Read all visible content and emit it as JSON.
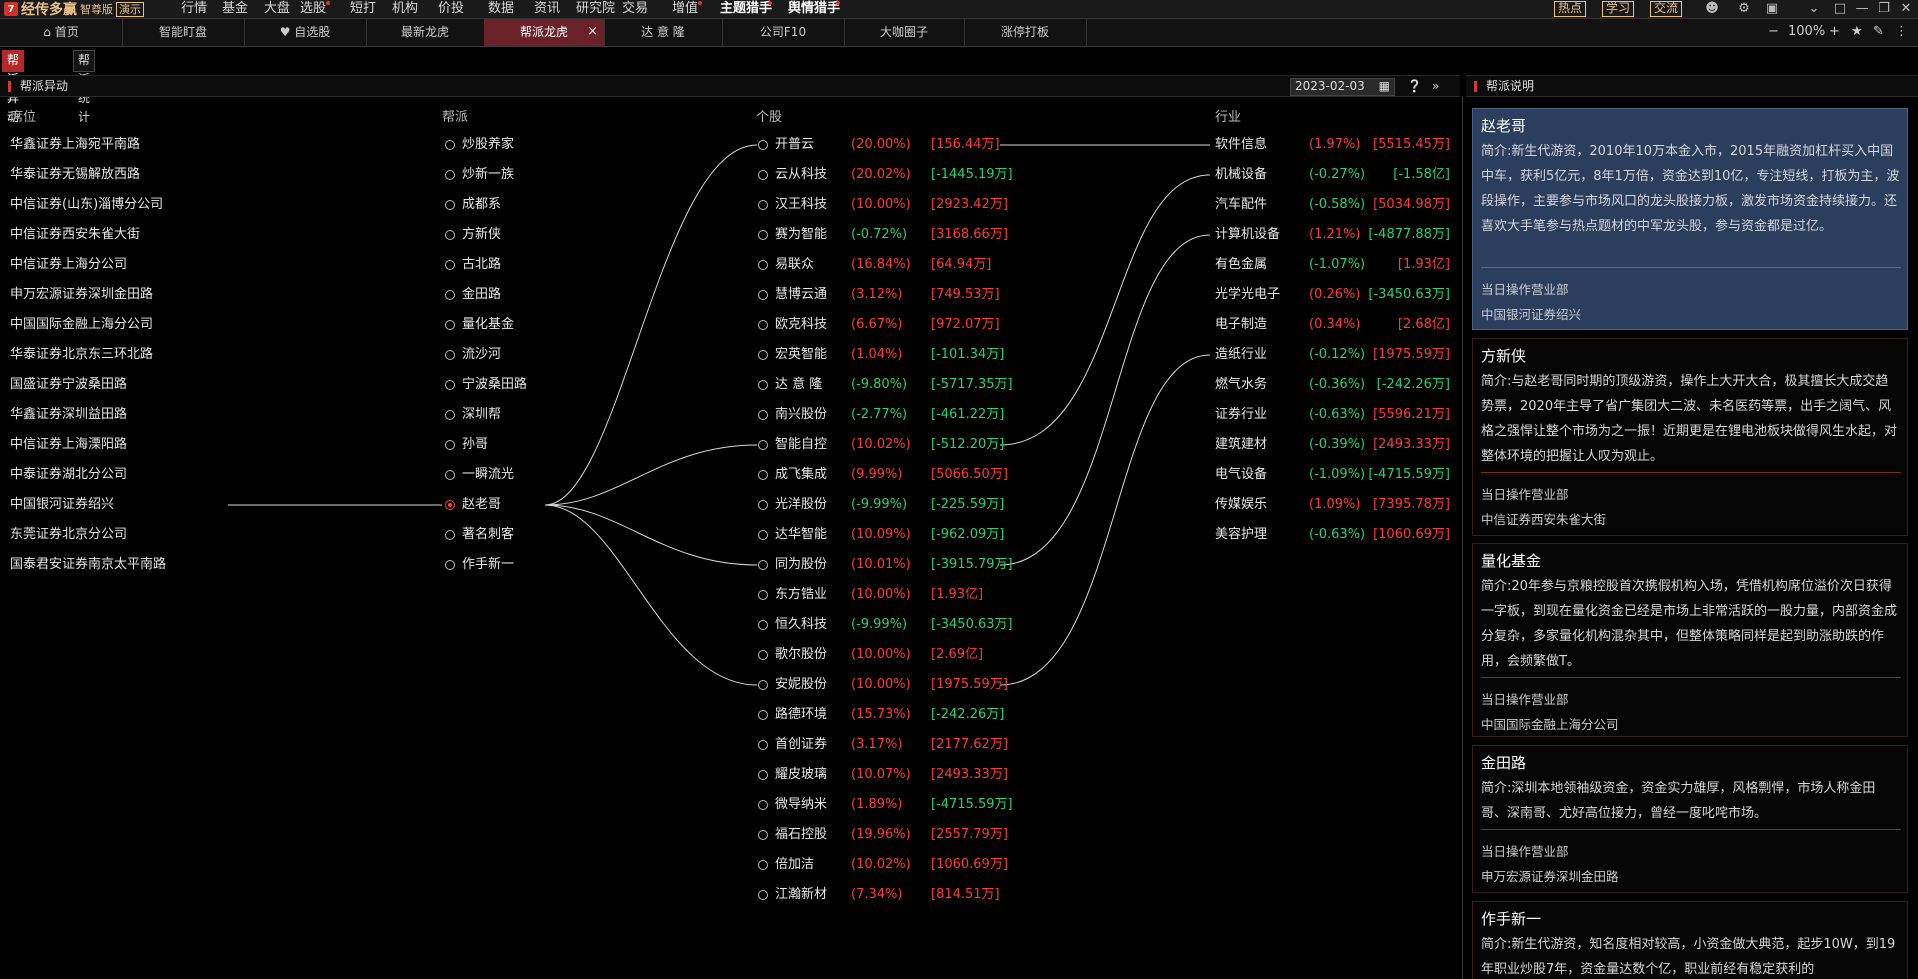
{
  "app": {
    "logo_mark": "7",
    "name": "经传多赢",
    "edition": "智尊版",
    "demo": "演示"
  },
  "menu": [
    {
      "label": "行情",
      "dot": false
    },
    {
      "label": "基金",
      "dot": false
    },
    {
      "label": "大盘",
      "dot": false
    },
    {
      "label": "选股",
      "dot": true
    },
    {
      "label": "短打",
      "dot": false
    },
    {
      "label": "机构",
      "dot": false
    },
    {
      "label": "价投",
      "dot": false
    },
    {
      "label": "数据",
      "dot": false
    },
    {
      "label": "资讯",
      "dot": false
    },
    {
      "label": "研究院",
      "dot": false
    },
    {
      "label": "交易",
      "dot": false
    },
    {
      "label": "增值",
      "dot": true
    },
    {
      "label": "主题猎手",
      "dot": true
    },
    {
      "label": "舆情猎手",
      "dot": true
    }
  ],
  "right_tags": [
    "热点",
    "学习",
    "交流"
  ],
  "window_icons": [
    "user-icon",
    "settings-icon",
    "skin-icon",
    "collapse-icon",
    "restore-icon",
    "minimize-icon",
    "maximize-icon",
    "close-icon"
  ],
  "tabs": [
    {
      "label": "首页",
      "icon": "home-icon"
    },
    {
      "label": "智能盯盘"
    },
    {
      "label": "自选股",
      "icon": "heart-icon"
    },
    {
      "label": "最新龙虎"
    },
    {
      "label": "帮派龙虎",
      "active": true,
      "close": "×"
    },
    {
      "label": "达 意 隆"
    },
    {
      "label": "公司F10"
    },
    {
      "label": "大咖圈子"
    },
    {
      "label": "涨停打板"
    }
  ],
  "zoom": {
    "minus": "−",
    "value": "100%",
    "plus": "+"
  },
  "subtabs": [
    {
      "label": "帮派异动",
      "active": true
    },
    {
      "label": "帮派统计"
    }
  ],
  "left_panel": {
    "title": "帮派异动",
    "date": "2023-02-03"
  },
  "right_panel": {
    "title": "帮派说明"
  },
  "columns": {
    "seat": "席位",
    "gang": "帮派",
    "stock": "个股",
    "industry": "行业"
  },
  "seats": [
    "华鑫证券上海宛平南路",
    "华泰证券无锡解放西路",
    "中信证券(山东)淄博分公司",
    "中信证券西安朱雀大街",
    "中信证券上海分公司",
    "申万宏源证券深圳金田路",
    "中国国际金融上海分公司",
    "华泰证券北京东三环北路",
    "国盛证券宁波桑田路",
    "华鑫证券深圳益田路",
    "中信证券上海溧阳路",
    "中泰证券湖北分公司",
    "中国银河证券绍兴",
    "东莞证券北京分公司",
    "国泰君安证券南京太平南路"
  ],
  "gangs": [
    {
      "name": "炒股养家"
    },
    {
      "name": "炒新一族"
    },
    {
      "name": "成都系"
    },
    {
      "name": "方新侠"
    },
    {
      "name": "古北路"
    },
    {
      "name": "金田路"
    },
    {
      "name": "量化基金"
    },
    {
      "name": "流沙河"
    },
    {
      "name": "宁波桑田路"
    },
    {
      "name": "深圳帮"
    },
    {
      "name": "孙哥"
    },
    {
      "name": "一瞬流光"
    },
    {
      "name": "赵老哥",
      "selected": true
    },
    {
      "name": "著名刺客"
    },
    {
      "name": "作手新一"
    }
  ],
  "stocks": [
    {
      "name": "开普云",
      "pct": "(20.00%)",
      "amt": "[156.44万]",
      "pct_dir": "up",
      "amt_dir": "up"
    },
    {
      "name": "云从科技",
      "pct": "(20.02%)",
      "amt": "[-1445.19万]",
      "pct_dir": "up",
      "amt_dir": "down"
    },
    {
      "name": "汉王科技",
      "pct": "(10.00%)",
      "amt": "[2923.42万]",
      "pct_dir": "up",
      "amt_dir": "up"
    },
    {
      "name": "赛为智能",
      "pct": "(-0.72%)",
      "amt": "[3168.66万]",
      "pct_dir": "down",
      "amt_dir": "up"
    },
    {
      "name": "易联众",
      "pct": "(16.84%)",
      "amt": "[64.94万]",
      "pct_dir": "up",
      "amt_dir": "up"
    },
    {
      "name": "慧博云通",
      "pct": "(3.12%)",
      "amt": "[749.53万]",
      "pct_dir": "up",
      "amt_dir": "up"
    },
    {
      "name": "欧克科技",
      "pct": "(6.67%)",
      "amt": "[972.07万]",
      "pct_dir": "up",
      "amt_dir": "up"
    },
    {
      "name": "宏英智能",
      "pct": "(1.04%)",
      "amt": "[-101.34万]",
      "pct_dir": "up",
      "amt_dir": "down"
    },
    {
      "name": "达 意 隆",
      "pct": "(-9.80%)",
      "amt": "[-5717.35万]",
      "pct_dir": "down",
      "amt_dir": "down"
    },
    {
      "name": "南兴股份",
      "pct": "(-2.77%)",
      "amt": "[-461.22万]",
      "pct_dir": "down",
      "amt_dir": "down"
    },
    {
      "name": "智能自控",
      "pct": "(10.02%)",
      "amt": "[-512.20万]",
      "pct_dir": "up",
      "amt_dir": "down"
    },
    {
      "name": "成飞集成",
      "pct": "(9.99%)",
      "amt": "[5066.50万]",
      "pct_dir": "up",
      "amt_dir": "up"
    },
    {
      "name": "光洋股份",
      "pct": "(-9.99%)",
      "amt": "[-225.59万]",
      "pct_dir": "down",
      "amt_dir": "down"
    },
    {
      "name": "达华智能",
      "pct": "(10.09%)",
      "amt": "[-962.09万]",
      "pct_dir": "up",
      "amt_dir": "down"
    },
    {
      "name": "同为股份",
      "pct": "(10.01%)",
      "amt": "[-3915.79万]",
      "pct_dir": "up",
      "amt_dir": "down"
    },
    {
      "name": "东方锆业",
      "pct": "(10.00%)",
      "amt": "[1.93亿]",
      "pct_dir": "up",
      "amt_dir": "up"
    },
    {
      "name": "恒久科技",
      "pct": "(-9.99%)",
      "amt": "[-3450.63万]",
      "pct_dir": "down",
      "amt_dir": "down"
    },
    {
      "name": "歌尔股份",
      "pct": "(10.00%)",
      "amt": "[2.69亿]",
      "pct_dir": "up",
      "amt_dir": "up"
    },
    {
      "name": "安妮股份",
      "pct": "(10.00%)",
      "amt": "[1975.59万]",
      "pct_dir": "up",
      "amt_dir": "up"
    },
    {
      "name": "路德环境",
      "pct": "(15.73%)",
      "amt": "[-242.26万]",
      "pct_dir": "up",
      "amt_dir": "down"
    },
    {
      "name": "首创证券",
      "pct": "(3.17%)",
      "amt": "[2177.62万]",
      "pct_dir": "up",
      "amt_dir": "up"
    },
    {
      "name": "耀皮玻璃",
      "pct": "(10.07%)",
      "amt": "[2493.33万]",
      "pct_dir": "up",
      "amt_dir": "up"
    },
    {
      "name": "微导纳米",
      "pct": "(1.89%)",
      "amt": "[-4715.59万]",
      "pct_dir": "up",
      "amt_dir": "down"
    },
    {
      "name": "福石控股",
      "pct": "(19.96%)",
      "amt": "[2557.79万]",
      "pct_dir": "up",
      "amt_dir": "up"
    },
    {
      "name": "倍加洁",
      "pct": "(10.02%)",
      "amt": "[1060.69万]",
      "pct_dir": "up",
      "amt_dir": "up"
    },
    {
      "name": "江瀚新材",
      "pct": "(7.34%)",
      "amt": "[814.51万]",
      "pct_dir": "up",
      "amt_dir": "up"
    }
  ],
  "industries": [
    {
      "name": "软件信息",
      "pct": "(1.97%)",
      "amt": "[5515.45万]",
      "pct_dir": "up",
      "amt_dir": "up"
    },
    {
      "name": "机械设备",
      "pct": "(-0.27%)",
      "amt": "[-1.58亿]",
      "pct_dir": "down",
      "amt_dir": "down"
    },
    {
      "name": "汽车配件",
      "pct": "(-0.58%)",
      "amt": "[5034.98万]",
      "pct_dir": "down",
      "amt_dir": "up"
    },
    {
      "name": "计算机设备",
      "pct": "(1.21%)",
      "amt": "[-4877.88万]",
      "pct_dir": "up",
      "amt_dir": "down"
    },
    {
      "name": "有色金属",
      "pct": "(-1.07%)",
      "amt": "[1.93亿]",
      "pct_dir": "down",
      "amt_dir": "up"
    },
    {
      "name": "光学光电子",
      "pct": "(0.26%)",
      "amt": "[-3450.63万]",
      "pct_dir": "up",
      "amt_dir": "down"
    },
    {
      "name": "电子制造",
      "pct": "(0.34%)",
      "amt": "[2.68亿]",
      "pct_dir": "up",
      "amt_dir": "up"
    },
    {
      "name": "造纸行业",
      "pct": "(-0.12%)",
      "amt": "[1975.59万]",
      "pct_dir": "down",
      "amt_dir": "up"
    },
    {
      "name": "燃气水务",
      "pct": "(-0.36%)",
      "amt": "[-242.26万]",
      "pct_dir": "down",
      "amt_dir": "down"
    },
    {
      "name": "证券行业",
      "pct": "(-0.63%)",
      "amt": "[5596.21万]",
      "pct_dir": "down",
      "amt_dir": "up"
    },
    {
      "name": "建筑建材",
      "pct": "(-0.39%)",
      "amt": "[2493.33万]",
      "pct_dir": "down",
      "amt_dir": "up"
    },
    {
      "name": "电气设备",
      "pct": "(-1.09%)",
      "amt": "[-4715.59万]",
      "pct_dir": "down",
      "amt_dir": "down"
    },
    {
      "name": "传媒娱乐",
      "pct": "(1.09%)",
      "amt": "[7395.78万]",
      "pct_dir": "up",
      "amt_dir": "up"
    },
    {
      "name": "美容护理",
      "pct": "(-0.63%)",
      "amt": "[1060.69万]",
      "pct_dir": "down",
      "amt_dir": "up"
    }
  ],
  "links": {
    "selected_seat_index": 12,
    "selected_gang_index": 12,
    "gang_to_stocks": [
      0,
      10,
      14,
      18
    ],
    "stock_to_industry": [
      [
        0,
        0
      ],
      [
        10,
        1
      ],
      [
        14,
        3
      ],
      [
        18,
        7
      ]
    ]
  },
  "cards": [
    {
      "title": "赵老哥",
      "active": true,
      "desc": "简介:新生代游资，2010年10万本金入市，2015年融资加杠杆买入中国中车，获利5亿元，8年1万倍，资金达到10亿，专注短线，打板为主，波段操作，主要参与市场风口的龙头股接力板，激发市场资金持续接力。还喜欢大手笔参与热点题材的中军龙头股，参与资金都是过亿。",
      "label": "当日操作营业部",
      "branch": "中国银河证券绍兴"
    },
    {
      "title": "方新侠",
      "active": false,
      "desc": "简介:与赵老哥同时期的顶级游资，操作上大开大合，极其擅长大成交趋势票，2020年主导了省广集团大二波、未名医药等票，出手之阔气、风格之强悍让整个市场为之一振！近期更是在锂电池板块做得风生水起，对整体环境的把握让人叹为观止。",
      "label": "当日操作营业部",
      "branch": "中信证券西安朱雀大街"
    },
    {
      "title": "量化基金",
      "active": false,
      "desc": "简介:20年参与京粮控股首次携假机构入场，凭借机构席位溢价次日获得一字板，到现在量化资金已经是市场上非常活跃的一股力量，内部资金成分复杂，多家量化机构混杂其中，但整体策略同样是起到助涨助跌的作用，会频繁做T。",
      "label": "当日操作营业部",
      "branch": "中国国际金融上海分公司"
    },
    {
      "title": "金田路",
      "active": false,
      "desc": "简介:深圳本地领袖级资金，资金实力雄厚，风格剽悍，市场人称金田哥、深南哥、尤好高位接力，曾经一度叱咤市场。",
      "label": "当日操作营业部",
      "branch": "申万宏源证券深圳金田路"
    },
    {
      "title": "作手新一",
      "active": false,
      "desc": "简介:新生代游资，知名度相对较高，小资金做大典范，起步10W，到19年职业炒股7年，资金量达数个亿，职业前经有稳定获利的",
      "label": "",
      "branch": ""
    }
  ]
}
